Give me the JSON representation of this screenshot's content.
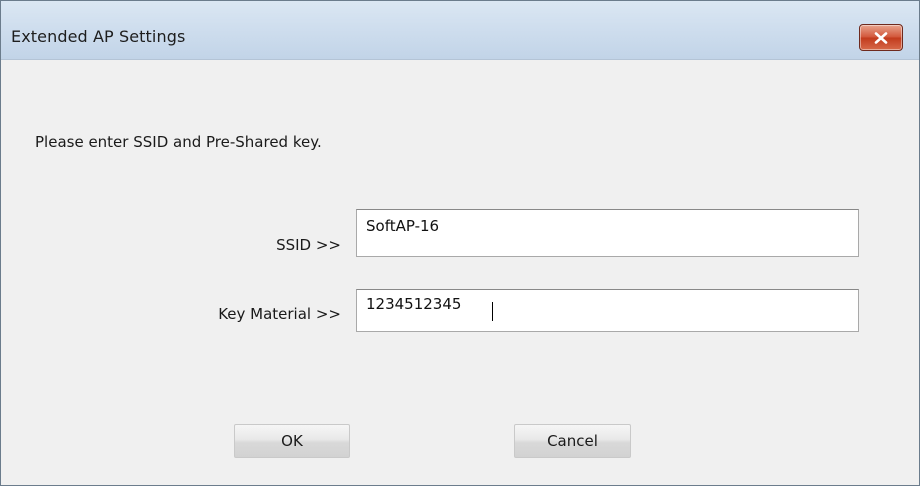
{
  "window": {
    "title": "Extended AP Settings",
    "close_icon": "close-icon"
  },
  "dialog": {
    "prompt": "Please enter SSID and Pre-Shared key.",
    "ssid": {
      "label": "SSID >>",
      "value": "SoftAP-16"
    },
    "key_material": {
      "label": "Key Material >>",
      "value": "1234512345"
    },
    "buttons": {
      "ok": "OK",
      "cancel": "Cancel"
    }
  },
  "colors": {
    "title_bar": "#cfdeee",
    "close_button": "#c84a2c",
    "dialog_background": "#f0f0f0"
  }
}
